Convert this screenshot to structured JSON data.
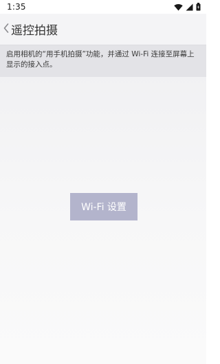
{
  "status_bar": {
    "time": "1:35",
    "icons": [
      "wifi-icon",
      "signal-icon",
      "battery-icon"
    ]
  },
  "header": {
    "back_icon": "chevron-left-icon",
    "title": "遥控拍摄"
  },
  "description": {
    "text": "启用相机的“用手机拍摄”功能，并通过 Wi-Fi 连接至屏幕上显示的接入点。"
  },
  "wifi_button": {
    "label": "Wi-Fi 设置"
  },
  "colors": {
    "header_bg": "#f4f4f6",
    "description_bg": "#e3e3e7",
    "button_bg": "#b3b4cc",
    "button_text": "#ffffff"
  }
}
